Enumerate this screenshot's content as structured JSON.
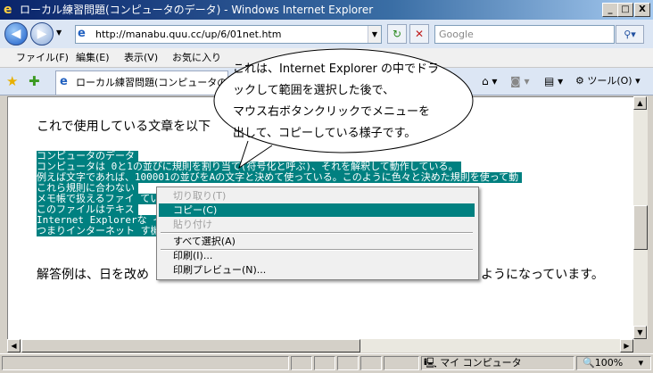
{
  "window": {
    "title": "ローカル練習問題(コンピュータのデータ) - Windows Internet Explorer",
    "ie_icon": "e",
    "min_glyph": "_",
    "max_glyph": "□",
    "close_glyph": "X"
  },
  "address_bar": {
    "back_glyph": "◀",
    "forward_glyph": "▶",
    "history_glyph": "▼",
    "page_icon": "e",
    "url": "http://manabu.quu.cc/up/6/01net.htm",
    "dropdown_glyph": "▼",
    "refresh_glyph": "↻",
    "stop_glyph": "✕",
    "search_placeholder": "Google",
    "search_glyph": "⚲▾"
  },
  "menu": {
    "items": [
      "ファイル(F)",
      "編集(E)",
      "表示(V)",
      "お気に入り"
    ]
  },
  "tabbar": {
    "favorites_glyph": "★",
    "add_favorites_glyph": "✚",
    "tab_icon": "e",
    "tab_label": "ローカル練習問題(コンピュータの",
    "home_glyph": "⌂ ▾",
    "feeds_glyph": "◙ ▾",
    "print_glyph": "▤ ▾",
    "tools_label": "⚙ ツール(O) ▾"
  },
  "content": {
    "para1": "これで使用している文章を以下",
    "selected_lines": [
      "コンピュータのデータ",
      "コンピュータは 0と1の並びに規則を割り当て(符号化と呼ぶ)、それを解釈して動作している。",
      "例えば文字であれば、100001の並びをAの文字と決めて使っている。このように色々と決めた規則を使って動",
      "これら規則に合わない",
      "メモ帳で扱えるファイ                                               ている。",
      "このファイルはテキス",
      "Internet Explorerな                                          イルで作られ、HTMLファイル",
      "つまりインターネット                                          す機能のソフトである。"
    ],
    "para2_left": "解答例は、日を改め",
    "para2_right": "ようになっています。"
  },
  "context_menu": {
    "cut": "切り取り(T)",
    "copy": "コピー(C)",
    "paste": "貼り付け",
    "select_all": "すべて選択(A)",
    "print": "印刷(I)...",
    "print_preview": "印刷プレビュー(N)..."
  },
  "balloon": {
    "lines": [
      "これは、Internet Explorer の中でドラ",
      "ックして範囲を選択した後で、",
      "マウス右ボタンクリックでメニューを",
      "出して、コピーしている様子です。"
    ]
  },
  "scrollbars": {
    "up": "▲",
    "down": "▼",
    "left": "◀",
    "right": "▶"
  },
  "status": {
    "zone_icon": "🖳",
    "zone": "マイ コンピュータ",
    "zoom": "🔍100%",
    "zoom_drop": "▾"
  }
}
